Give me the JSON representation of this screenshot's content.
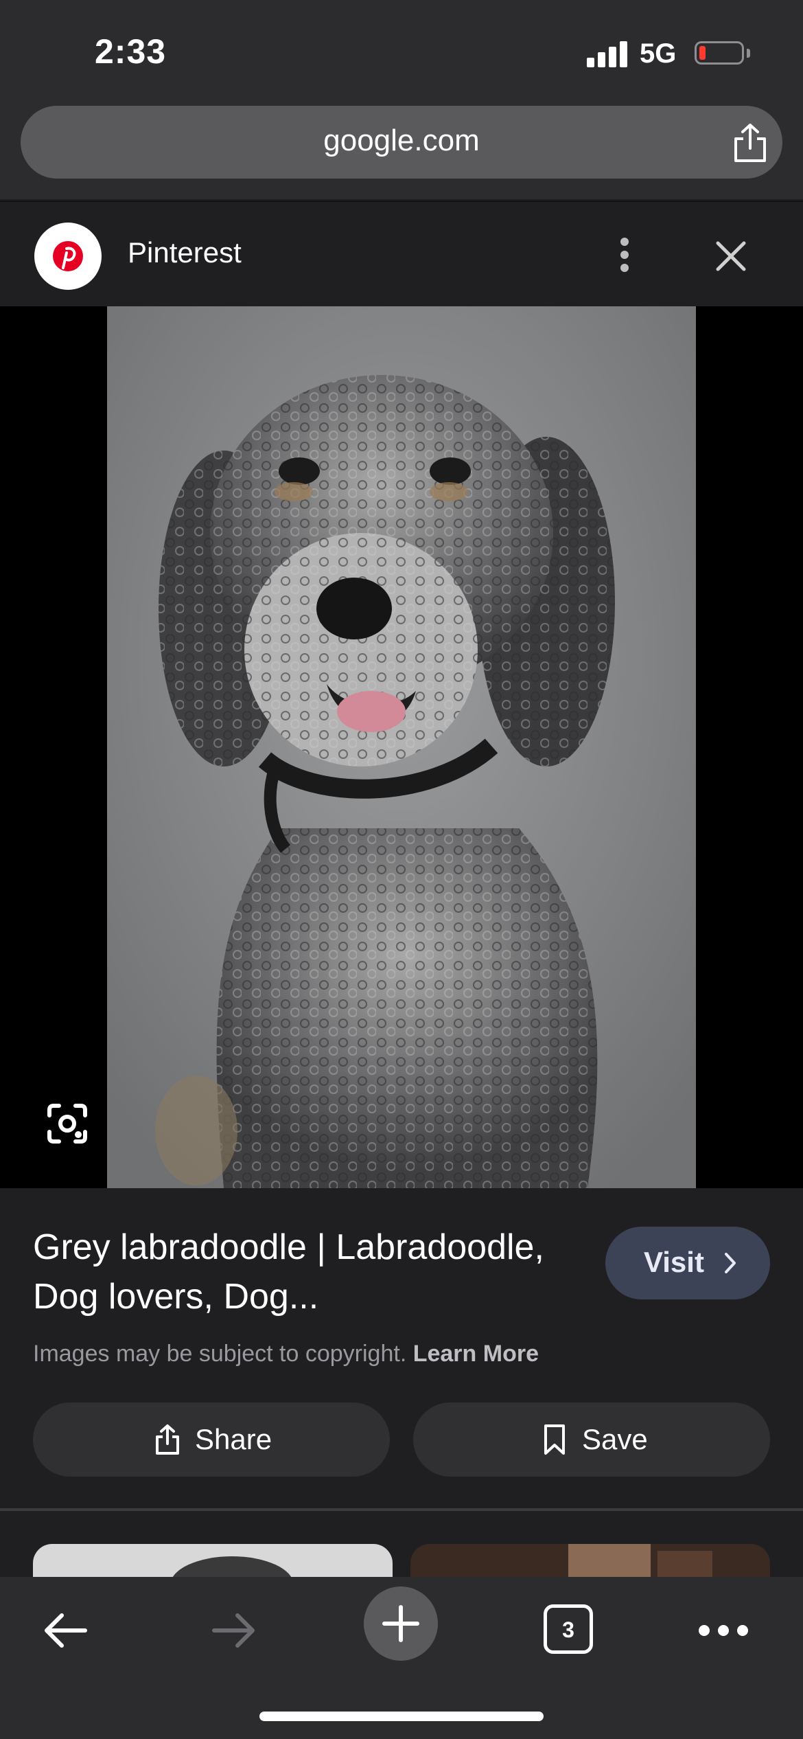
{
  "status_bar": {
    "time": "2:33",
    "network": "5G",
    "battery_level": "low"
  },
  "browser": {
    "url": "google.com",
    "tab_count": "3"
  },
  "source": {
    "name": "Pinterest",
    "brand_color": "#e60023"
  },
  "result": {
    "title": "Grey labradoodle | Labradoodle, Dog lovers, Dog...",
    "visit_label": "Visit",
    "copyright_text": "Images may be subject to copyright.",
    "learn_more_label": "Learn More",
    "share_label": "Share",
    "save_label": "Save"
  },
  "icons": {
    "top_share": "share-icon",
    "more": "more-vertical-icon",
    "close": "close-icon",
    "lens": "google-lens-icon",
    "back": "back-arrow-icon",
    "forward": "forward-arrow-icon",
    "new_tab": "plus-icon",
    "tabs": "tabs-icon",
    "menu": "more-horizontal-icon"
  }
}
